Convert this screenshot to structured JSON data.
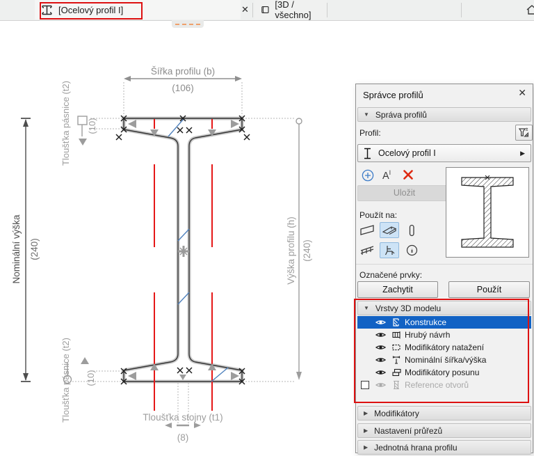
{
  "tabs": [
    {
      "label": "[Ocelový profil I]",
      "close_glyph": "✕"
    },
    {
      "label": "[3D / všechno]"
    }
  ],
  "canvas": {
    "width": {
      "label": "Šířka profilu (b)",
      "value": "(106)"
    },
    "flange_top": {
      "label": "Tloušťka pásnice (t2)",
      "value": "(10)"
    },
    "flange_bottom": {
      "label": "Tloušťka pásnice (t2)",
      "value": "(10)"
    },
    "nominal_height": {
      "label": "Nominální výška",
      "value": "(240)"
    },
    "profile_height": {
      "label": "Výška profilu (h)",
      "value": "(240)"
    },
    "web": {
      "label": "Tloušťka stojny (t1)",
      "value": "(8)"
    }
  },
  "panel": {
    "title": "Správce profilů",
    "close_glyph": "✕",
    "section_management": "Správa profilů",
    "profil_label": "Profil:",
    "profile_name": "Ocelový profil I",
    "save_label": "Uložit",
    "apply_to_label": "Použít na:",
    "selected_elements_label": "Označené prvky:",
    "capture_label": "Zachytit",
    "apply_label": "Použít",
    "layers_header": "Vrstvy 3D modelu",
    "collapsed": [
      {
        "label": "Modifikátory"
      },
      {
        "label": "Nastavení průřezů"
      },
      {
        "label": "Jednotná hrana profilu"
      }
    ]
  },
  "layers": {
    "items": [
      {
        "label": "Konstrukce",
        "selected": true,
        "visible": true
      },
      {
        "label": "Hrubý návrh",
        "visible": true
      },
      {
        "label": "Modifikátory natažení",
        "visible": true
      },
      {
        "label": "Nominální šířka/výška",
        "visible": true
      },
      {
        "label": "Modifikátory posunu",
        "visible": true
      },
      {
        "label": "Reference otvorů",
        "disabled": true,
        "checkbox_checked": false
      }
    ]
  },
  "icons": {
    "tri_down": "▼",
    "tri_right": "▶",
    "arrow_right_small": "▶",
    "rename_a": "A",
    "rename_sup": "I"
  },
  "colors": {
    "selection_blue": "#1262c4",
    "annotation_red": "#dd1111",
    "modifier_line_red": "#e51717",
    "diagonal_blue": "#4f81bd",
    "dash_orange": "#efa06b",
    "selected_iconbtn_bg": "#cde3f6"
  }
}
